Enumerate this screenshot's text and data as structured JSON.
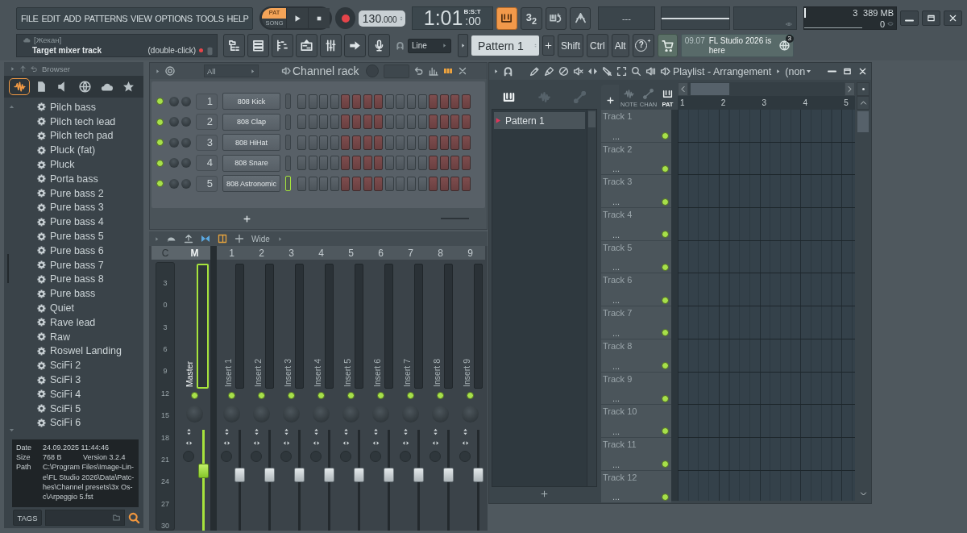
{
  "menu": [
    "FILE",
    "EDIT",
    "ADD",
    "PATTERNS",
    "VIEW",
    "OPTIONS",
    "TOOLS",
    "HELP"
  ],
  "transport": {
    "modes": [
      {
        "label": "PAT",
        "selected": true
      },
      {
        "label": "SONG",
        "selected": false
      }
    ],
    "tempo": "130",
    "tempo_fraction": ".000",
    "time": "1:01",
    "time_ticks": ":00",
    "time_format": "B:S:T"
  },
  "toggles": [
    {
      "kind": "keyboard",
      "on": true
    },
    {
      "kind": "countdown",
      "label": "3$_{2}$",
      "on": false
    },
    {
      "kind": "loop",
      "on": false
    },
    {
      "kind": "metronome",
      "on": false
    }
  ],
  "display": {
    "text": "---"
  },
  "monitor": {
    "cpu": "3",
    "memory": "389 MB",
    "polyphony": "0"
  },
  "hint": {
    "title": "[Жекан]",
    "text": "Target mixer track",
    "action": "(double-click)"
  },
  "snap": {
    "value": "Line"
  },
  "pattern_selector": {
    "value": "Pattern 1"
  },
  "modifiers": [
    "Shift",
    "Ctrl",
    "Alt"
  ],
  "help": {
    "label": "?"
  },
  "news": {
    "date": "09.07",
    "title": "FL Studio 2026 is here",
    "count": "3"
  },
  "browser": {
    "title": "Browser",
    "tabs": [
      {
        "kind": "audio",
        "selected": true
      },
      {
        "kind": "files",
        "selected": false
      },
      {
        "kind": "speaker",
        "selected": false
      },
      {
        "kind": "globe",
        "selected": false
      },
      {
        "kind": "cloud",
        "selected": false
      },
      {
        "kind": "star",
        "selected": false
      }
    ],
    "items": [
      "Pilch bass",
      "Pilch tech lead",
      "Pilch tech pad",
      "Pluck (fat)",
      "Pluck",
      "Porta bass",
      "Pure bass 2",
      "Pure bass 3",
      "Pure bass 4",
      "Pure bass 5",
      "Pure bass 6",
      "Pure bass 7",
      "Pure bass 8",
      "Pure bass",
      "Quiet",
      "Rave lead",
      "Raw",
      "Roswel Landing",
      "SciFi 2",
      "SciFi 3",
      "SciFi 4",
      "SciFi 5",
      "SciFi 6"
    ],
    "info": {
      "date_label": "Date",
      "date": "24.09.2025 11:44:46",
      "size_label": "Size",
      "size": "768 B",
      "version": "Version 3.2.4",
      "path_label": "Path",
      "path_lines": [
        "C:\\Program Files\\Image-Lin-",
        "e\\FL Studio 2026\\Data\\Patc-",
        "hes\\Channel presets\\3x Os-",
        "c\\Arpeggio 5.fst"
      ]
    },
    "tags_label": "TAGS"
  },
  "channel_rack": {
    "filter": "All",
    "title": "Channel rack",
    "channels": [
      {
        "number": "1",
        "name": "808 Kick",
        "selected": false
      },
      {
        "number": "2",
        "name": "808 Clap",
        "selected": false
      },
      {
        "number": "3",
        "name": "808 HiHat",
        "selected": false
      },
      {
        "number": "4",
        "name": "808 Snare",
        "selected": false
      },
      {
        "number": "5",
        "name": "808 Astronomic",
        "selected": true
      }
    ]
  },
  "mixer": {
    "view": "Wide",
    "current": "C",
    "scale": [
      "3",
      "0",
      "3",
      "6",
      "9",
      "12",
      "15",
      "18",
      "21",
      "24",
      "27",
      "30"
    ],
    "tracks": [
      {
        "header": "M",
        "name": "Master",
        "selected": true,
        "level": 0.59
      },
      {
        "header": "1",
        "name": "Insert 1",
        "selected": false,
        "level": 0.55
      },
      {
        "header": "2",
        "name": "Insert 2",
        "selected": false,
        "level": 0.55
      },
      {
        "header": "3",
        "name": "Insert 3",
        "selected": false,
        "level": 0.55
      },
      {
        "header": "4",
        "name": "Insert 4",
        "selected": false,
        "level": 0.55
      },
      {
        "header": "5",
        "name": "Insert 5",
        "selected": false,
        "level": 0.55
      },
      {
        "header": "6",
        "name": "Insert 6",
        "selected": false,
        "level": 0.55
      },
      {
        "header": "7",
        "name": "Insert 7",
        "selected": false,
        "level": 0.55
      },
      {
        "header": "8",
        "name": "Insert 8",
        "selected": false,
        "level": 0.55
      },
      {
        "header": "9",
        "name": "Insert 9",
        "selected": false,
        "level": 0.55
      }
    ]
  },
  "playlist": {
    "title": "Playlist - Arrangement",
    "arrangement": "(non",
    "pickers": [
      {
        "kind": "pattern",
        "selected": true
      },
      {
        "kind": "audio",
        "selected": false
      },
      {
        "kind": "automation",
        "selected": false
      }
    ],
    "patterns": [
      {
        "name": "Pattern 1",
        "selected": true
      }
    ],
    "tabs": [
      {
        "kind": "note",
        "label": "NOTE",
        "selected": false
      },
      {
        "kind": "chan",
        "label": "CHAN",
        "selected": false
      },
      {
        "kind": "pat",
        "label": "PAT",
        "selected": true
      }
    ],
    "ruler": [
      "1",
      "2",
      "3",
      "4",
      "5"
    ],
    "tracks": [
      {
        "name": "Track 1",
        "detail": "..."
      },
      {
        "name": "Track 2",
        "detail": "..."
      },
      {
        "name": "Track 3",
        "detail": "..."
      },
      {
        "name": "Track 4",
        "detail": "..."
      },
      {
        "name": "Track 5",
        "detail": "..."
      },
      {
        "name": "Track 6",
        "detail": "..."
      },
      {
        "name": "Track 7",
        "detail": "..."
      },
      {
        "name": "Track 8",
        "detail": "..."
      },
      {
        "name": "Track 9",
        "detail": "..."
      },
      {
        "name": "Track 10",
        "detail": "..."
      },
      {
        "name": "Track 11",
        "detail": "..."
      },
      {
        "name": "Track 12",
        "detail": "..."
      }
    ]
  }
}
